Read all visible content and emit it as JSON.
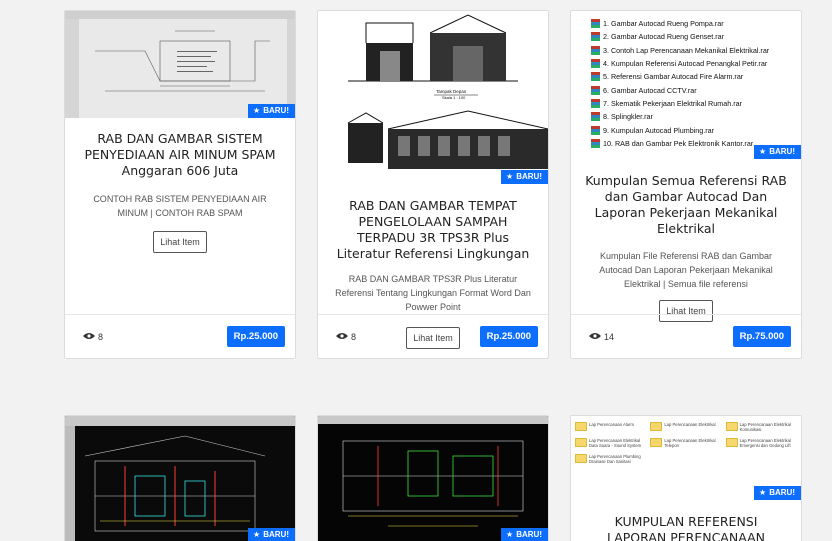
{
  "badge_label": "BARU!",
  "cards": [
    {
      "title": "RAB DAN GAMBAR SISTEM PENYEDIAAN AIR MINUM SPAM Anggaran 606 Juta",
      "description": "CONTOH RAB SISTEM PENYEDIAAN AIR MINUM | CONTOH RAB SPAM",
      "button": "Lihat Item",
      "views": "8",
      "price": "Rp.25.000"
    },
    {
      "title": "RAB DAN GAMBAR TEMPAT PENGELOLAAN SAMPAH TERPADU 3R TPS3R Plus Literatur Referensi Lingkungan",
      "description": "RAB DAN GAMBAR TPS3R Plus Literatur Referensi Tentang Lingkungan Format Word Dan Powwer Point",
      "button": "Lihat Item",
      "views": "8",
      "price": "Rp.25.000"
    },
    {
      "title": "Kumpulan Semua Referensi RAB dan Gambar Autocad Dan Laporan Pekerjaan Mekanikal Elektrikal",
      "description": "Kumpulan File Referensi RAB dan Gambar Autocad Dan Laporan Pekerjaan Mekanikal Elektrikal | Semua file referensi",
      "button": "Lihat Item",
      "views": "14",
      "price": "Rp.75.000"
    },
    {
      "title": "",
      "description": ""
    },
    {
      "title": "",
      "description": ""
    },
    {
      "title": "KUMPULAN REFERENSI LAPORAN PERENCANAAN",
      "description": ""
    }
  ],
  "thumb2": {
    "plan_label": "Tampak Depan",
    "plan_scale": "Skala 1 : 100"
  },
  "thumb3_files": [
    "1. Gambar Autocad Rueng Pompa.rar",
    "2. Gambar Autocad Rueng Genset.rar",
    "3. Contoh Lap Perencanaan Mekanikal Elektrikal.rar",
    "4. Kumpulan Referensi Autocad Penangkal Petir.rar",
    "5. Referensi Gambar Autocad Fire Alarm.rar",
    "6. Gambar Autocad CCTV.rar",
    "7. Skematik Pekerjaan Elektrikal Rumah.rar",
    "8. Splingkler.rar",
    "9. Kumpulan Autocad Plumbing.rar",
    "10. RAB dan Gambar Pek Elektronik Kantor.rar"
  ],
  "thumb6_folders": [
    "Lap Perencanaan Alarm",
    "Lap Perencanaan Elektrikal",
    "Lap Perencanaan Elektrikal Komunikasi",
    "Lap Perencanaan Elektrikal Data Suara - Sound System",
    "Lap Perencanaan Elektrikal Telepon",
    "Lap Perencanaan Elektrikal Emergensi dan Gedung Lift",
    "Lap Perencanaan Plumbing Drainase Dan Sanitasi"
  ]
}
